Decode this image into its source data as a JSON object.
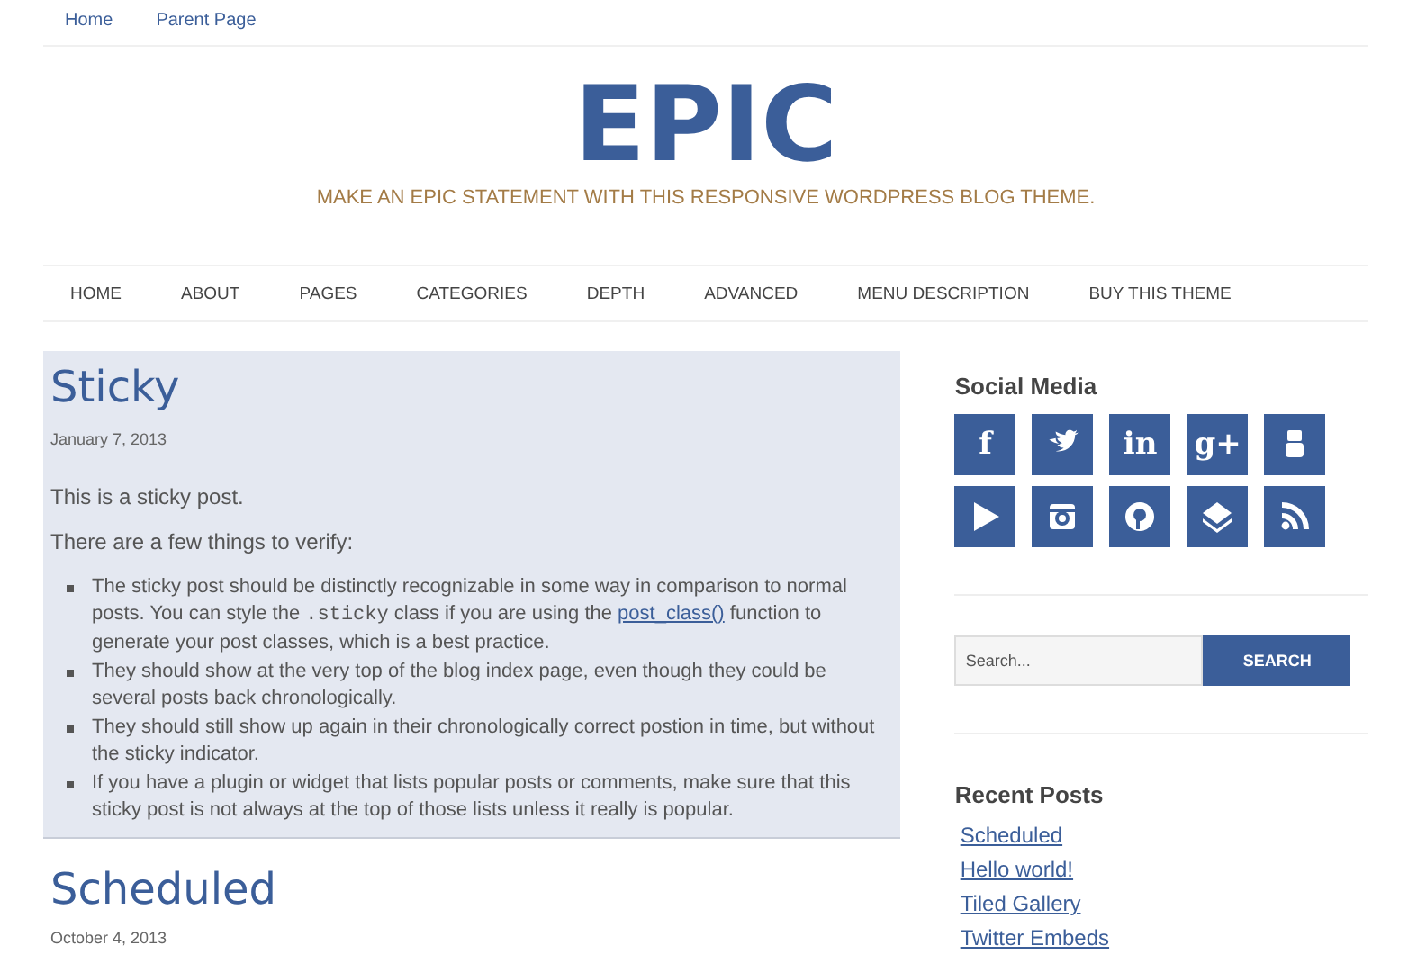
{
  "top_nav": [
    "Home",
    "Parent Page"
  ],
  "site": {
    "title": "EPIC",
    "tagline": "MAKE AN EPIC STATEMENT WITH THIS RESPONSIVE WORDPRESS BLOG THEME."
  },
  "main_nav": [
    "HOME",
    "ABOUT",
    "PAGES",
    "CATEGORIES",
    "DEPTH",
    "ADVANCED",
    "MENU DESCRIPTION",
    "BUY THIS THEME"
  ],
  "posts": [
    {
      "title": "Sticky",
      "date": "January 7, 2013",
      "sticky": true,
      "paragraphs": [
        "This is a sticky post.",
        "There are a few things to verify:"
      ],
      "bullets": [
        {
          "parts": [
            {
              "kind": "text",
              "text": "The sticky post should be distinctly recognizable in some way in comparison to normal posts. You can style the "
            },
            {
              "kind": "code",
              "text": ".sticky"
            },
            {
              "kind": "text",
              "text": " class if you are using the "
            },
            {
              "kind": "link",
              "text": "post_class()"
            },
            {
              "kind": "text",
              "text": " function to generate your post classes, which is a best practice."
            }
          ]
        },
        {
          "parts": [
            {
              "kind": "text",
              "text": "They should show at the very top of the blog index page, even though they could be several posts back chronologically."
            }
          ]
        },
        {
          "parts": [
            {
              "kind": "text",
              "text": "They should still show up again in their chronologically correct postion in time, but without the sticky indicator."
            }
          ]
        },
        {
          "parts": [
            {
              "kind": "text",
              "text": "If you have a plugin or widget that lists popular posts or comments, make sure that this sticky post is not always at the top of those lists unless it really is popular."
            }
          ]
        }
      ]
    },
    {
      "title": "Scheduled",
      "date": "October 4, 2013",
      "sticky": false
    }
  ],
  "sidebar": {
    "social": {
      "title": "Social Media",
      "icons": [
        {
          "kind": "letters",
          "glyph": "f"
        },
        {
          "kind": "bird"
        },
        {
          "kind": "letters",
          "glyph": "in"
        },
        {
          "kind": "letters",
          "glyph": "g+"
        },
        {
          "kind": "tube"
        },
        {
          "kind": "play"
        },
        {
          "kind": "camera"
        },
        {
          "kind": "pin"
        },
        {
          "kind": "stack"
        },
        {
          "kind": "rss"
        }
      ]
    },
    "search": {
      "placeholder": "Search...",
      "button": "SEARCH"
    },
    "recent": {
      "title": "Recent Posts",
      "links": [
        "Scheduled",
        "Hello world!",
        "Tiled Gallery",
        "Twitter Embeds"
      ]
    }
  }
}
